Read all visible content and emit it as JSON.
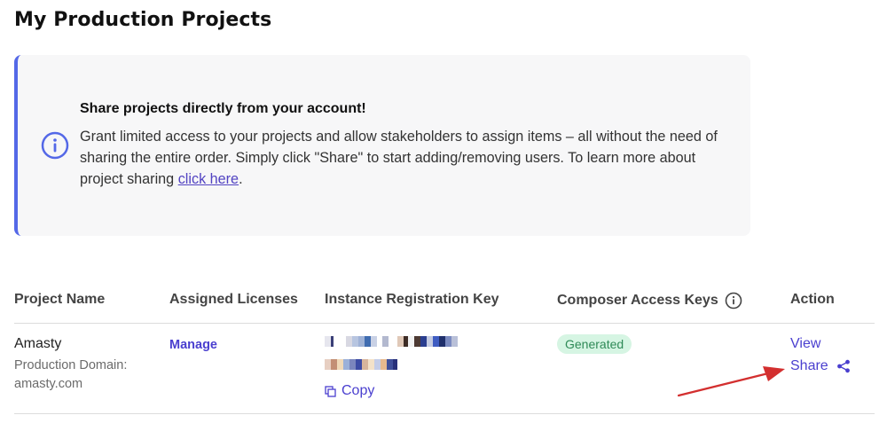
{
  "page": {
    "title": "My Production Projects"
  },
  "info_banner": {
    "title": "Share projects directly from your account!",
    "body_text": "Grant limited access to your projects and allow stakeholders to assign items – all without the need of sharing the entire order. Simply click \"Share\" to start adding/removing users. To learn more about project sharing ",
    "link_text": "click here",
    "trailing": ".",
    "accent_color": "#5468e7",
    "icon": "info-circle-icon"
  },
  "table": {
    "headers": {
      "project_name": "Project Name",
      "assigned_licenses": "Assigned Licenses",
      "instance_registration_key": "Instance Registration Key",
      "composer_access_keys": "Composer Access Keys",
      "action": "Action"
    },
    "rows": [
      {
        "project_name": "Amasty",
        "domain_label": "Production Domain:",
        "domain_value": "amasty.com",
        "licenses_action": "Manage",
        "copy_label": "Copy",
        "composer_status": "Generated",
        "actions": {
          "view": "View",
          "share": "Share"
        }
      }
    ]
  },
  "colors": {
    "link": "#4a3fcf",
    "badge_bg": "#d6f5e3",
    "badge_text": "#2f8a57",
    "annotation_arrow": "#d32f2f"
  }
}
